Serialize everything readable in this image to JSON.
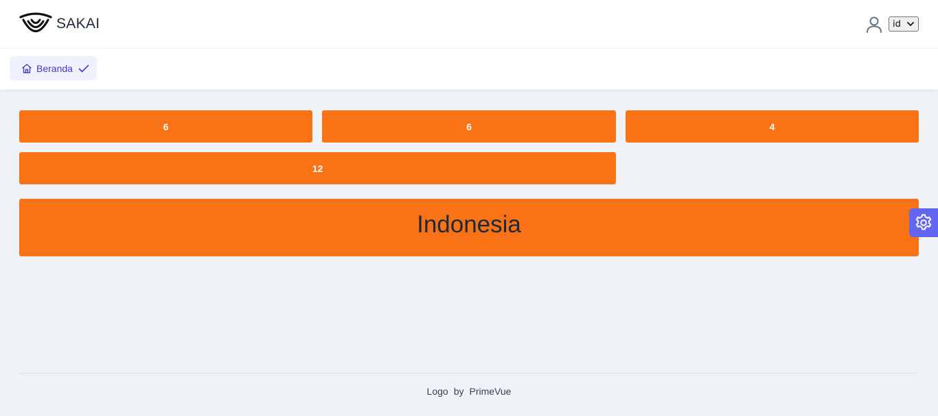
{
  "header": {
    "brand": "SAKAI",
    "logo_icon": "sakai-logo-icon",
    "user_icon": "user-icon",
    "language_select": {
      "selected": "id"
    }
  },
  "tabs": [
    {
      "label": "Beranda",
      "icon": "home-icon",
      "status_icon": "check-icon",
      "active": true
    }
  ],
  "grid_boxes": [
    {
      "label": "6"
    },
    {
      "label": "6"
    },
    {
      "label": "4"
    },
    {
      "label": "12"
    }
  ],
  "banner": {
    "text": "Indonesia"
  },
  "config_button": {
    "icon": "gear-icon"
  },
  "footer": {
    "logo_text": "Logo",
    "by_text": "by",
    "brand_text": "PrimeVue"
  },
  "colors": {
    "accent_orange": "#f97316",
    "primary_indigo": "#6366f1",
    "tab_background": "#eef2ff",
    "page_background": "#eff3f8"
  }
}
